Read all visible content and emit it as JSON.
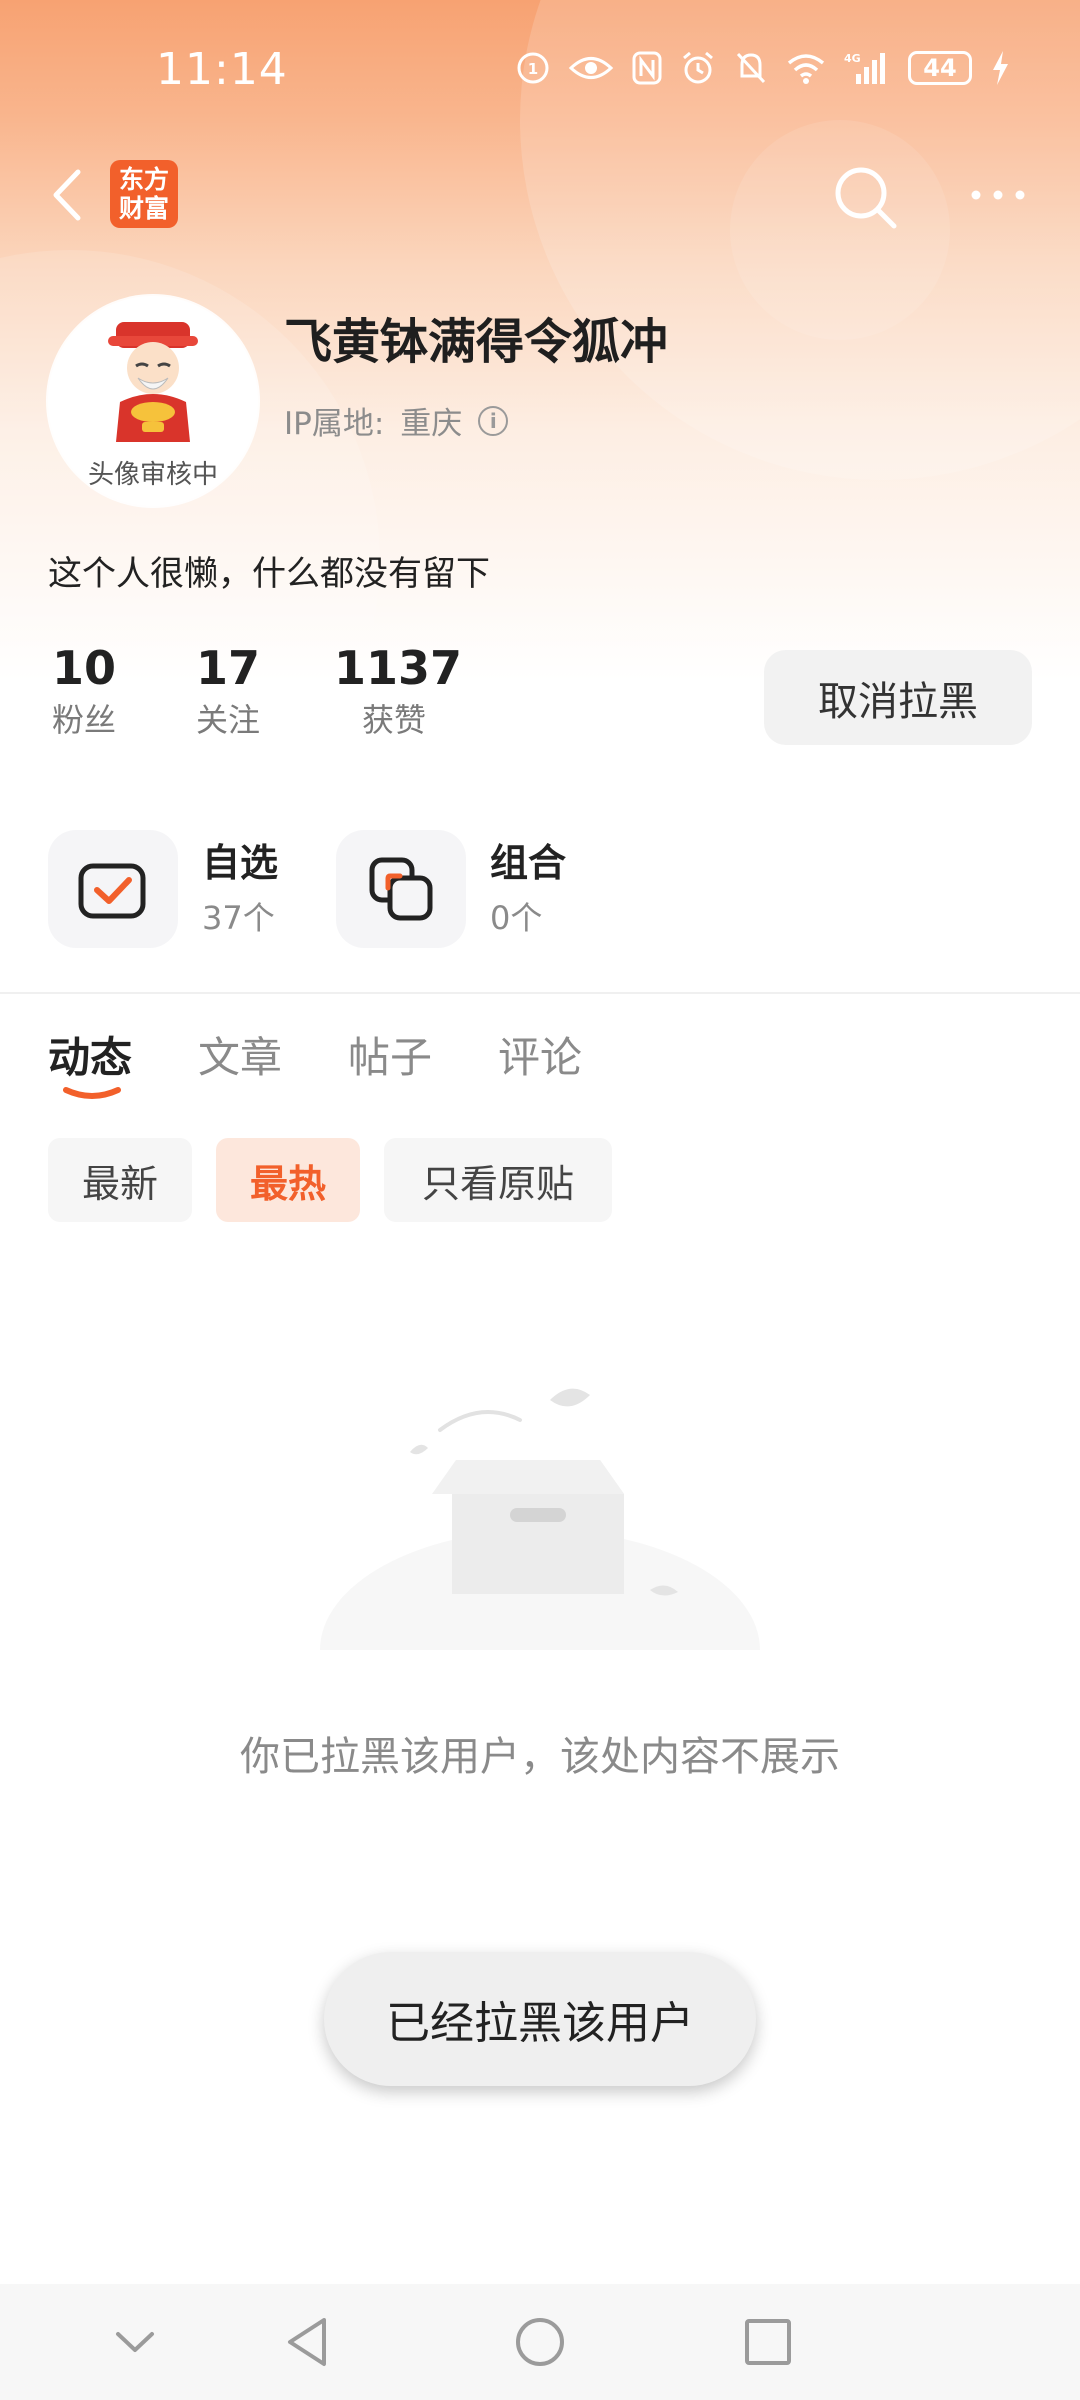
{
  "status_bar": {
    "time": "11:14",
    "network": "4G",
    "battery": "44"
  },
  "header": {
    "app_logo": [
      "东方",
      "财富"
    ]
  },
  "profile": {
    "avatar_caption": "头像审核中",
    "username": "飞黄钵满得令狐冲",
    "ip_label": "IP属地:",
    "ip_location": "重庆",
    "bio": "这个人很懒，什么都没有留下",
    "stats": [
      {
        "value": "10",
        "label": "粉丝"
      },
      {
        "value": "17",
        "label": "关注"
      },
      {
        "value": "1137",
        "label": "获赞"
      }
    ],
    "unblock_button": "取消拉黑"
  },
  "shortcuts": [
    {
      "title": "自选",
      "count": "37个"
    },
    {
      "title": "组合",
      "count": "0个"
    }
  ],
  "tabs": [
    {
      "label": "动态",
      "active": true
    },
    {
      "label": "文章",
      "active": false
    },
    {
      "label": "帖子",
      "active": false
    },
    {
      "label": "评论",
      "active": false
    }
  ],
  "filters": [
    {
      "label": "最新",
      "active": false
    },
    {
      "label": "最热",
      "active": true
    },
    {
      "label": "只看原贴",
      "active": false
    }
  ],
  "empty_state": {
    "message": "你已拉黑该用户，该处内容不展示"
  },
  "toast": {
    "message": "已经拉黑该用户"
  },
  "colors": {
    "accent": "#f2602b",
    "header_gradient_top": "#f7a272"
  }
}
